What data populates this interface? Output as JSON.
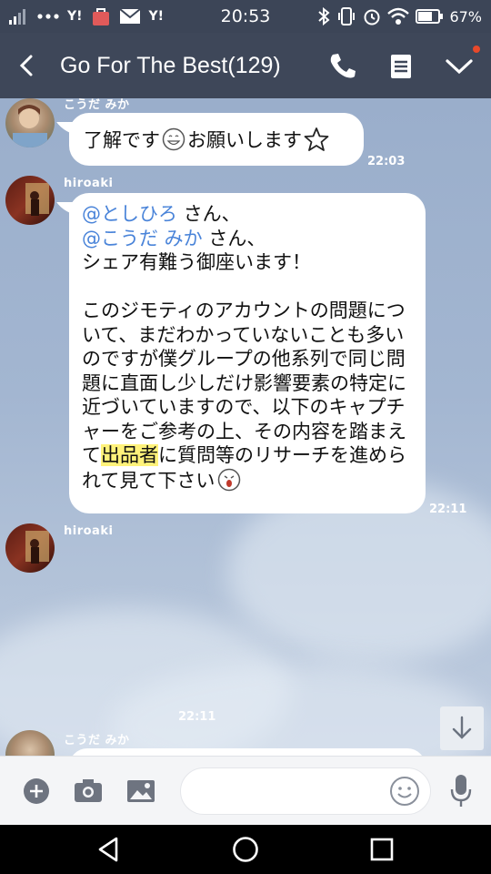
{
  "status_bar": {
    "carrier_icons": [
      "Y!",
      "Y!"
    ],
    "time": "20:53",
    "battery": "67%"
  },
  "header": {
    "title": "Go For The Best(129)"
  },
  "messages": [
    {
      "sender": "こうだ みか",
      "text_before_emoji": "了解です",
      "text_after_emoji": "お願いします",
      "time": "22:03"
    },
    {
      "sender": "hiroaki",
      "mention1": "@としひろ",
      "suffix1": " さん、",
      "mention2": "@こうだ みか",
      "suffix2": " さん、",
      "line3": "シェア有難う御座います！",
      "para2_a": "このジモティのアカウントの問題について、まだわかっていないことも多いのですが僕グループの他系列で同じ問題に直面し少しだけ影響要素の特定に近づいていますので、以下のキャプチャーをご参考の上、その内容を踏まえて",
      "para2_highlight": "出品者",
      "para2_b": "に質問等のリサーチを進められて見て下さい",
      "time": "22:11"
    },
    {
      "sender": "hiroaki",
      "time": "22:11"
    },
    {
      "sender": "こうだ みか"
    }
  ],
  "colors": {
    "header_bg": "#3e4759",
    "mention": "#4a84d9",
    "highlight": "#fff27a"
  }
}
